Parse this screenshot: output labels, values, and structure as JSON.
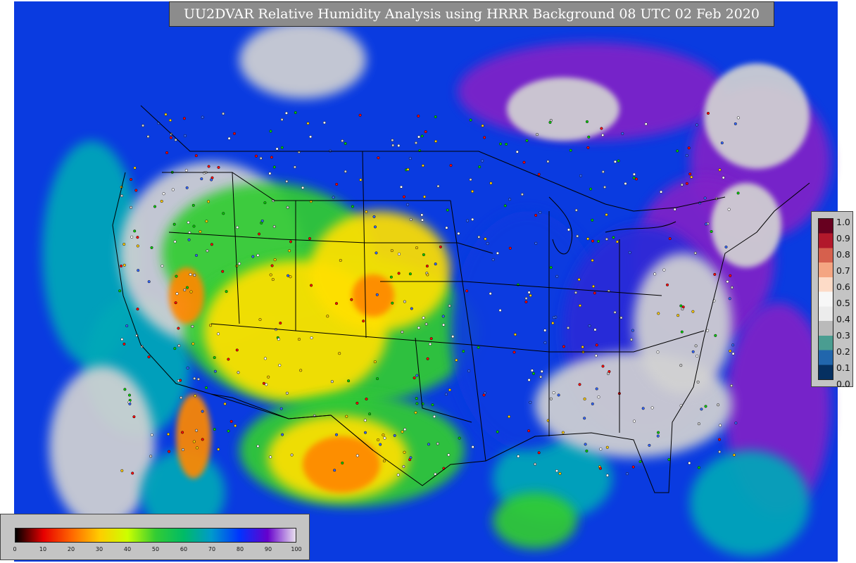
{
  "title": "UU2DVAR Relative Humidity Analysis using HRRR Background 08 UTC 02 Feb 2020",
  "side_legend": {
    "ticks": [
      "1.0",
      "0.9",
      "0.8",
      "0.7",
      "0.6",
      "0.5",
      "0.4",
      "0.3",
      "0.2",
      "0.1",
      "0.0"
    ],
    "colors_top_to_bottom": [
      "#67001f",
      "#b2182b",
      "#d6604d",
      "#f4a582",
      "#fddbc7",
      "#f7f7f7",
      "#ececec",
      "#bababa",
      "#4a9d91",
      "#2166ac",
      "#053061"
    ]
  },
  "bottom_legend": {
    "ticks": [
      "0",
      "10",
      "20",
      "30",
      "40",
      "50",
      "60",
      "70",
      "80",
      "90",
      "100"
    ],
    "colors": [
      "#000000",
      "#e60000",
      "#ff6600",
      "#ffcc00",
      "#ccff00",
      "#33cc33",
      "#00bb66",
      "#0099cc",
      "#0033ff",
      "#6600cc",
      "#e8e0ee"
    ]
  },
  "map_colors": {
    "ocean_blue": "#0a3be0",
    "ocean_teal": "#00a8b8",
    "dry_green": "#33cc33",
    "dry_yellow": "#ffe000",
    "dry_orange": "#ff8800",
    "moist_purple": "#8020c8",
    "saturated_gray": "#d2d2d2",
    "boundary": "#000000"
  }
}
